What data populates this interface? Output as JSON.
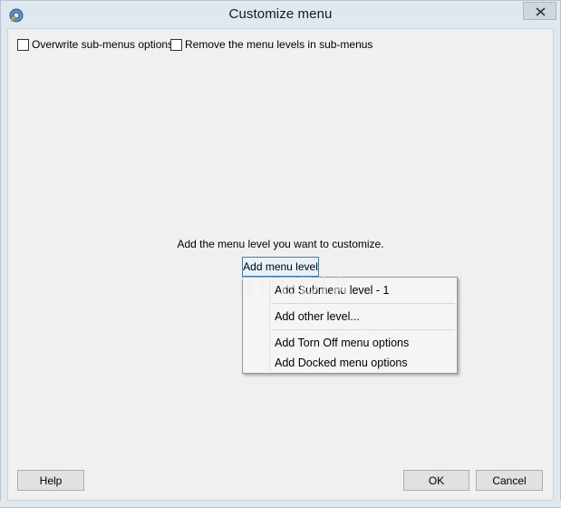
{
  "window": {
    "title": "Customize menu",
    "close_icon": "close-icon",
    "app_icon": "gear-wrench-icon"
  },
  "options": {
    "overwrite_label": "Overwrite sub-menus options",
    "remove_levels_label": "Remove the menu levels in sub-menus"
  },
  "main": {
    "prompt": "Add the menu level you want to customize.",
    "add_button": "Add menu level"
  },
  "menu": {
    "items": [
      {
        "label": "Add Submenu level - 1"
      },
      {
        "label": "Add other level..."
      },
      {
        "label": "Add Torn Off menu options"
      },
      {
        "label": "Add Docked menu options"
      }
    ]
  },
  "watermark": "SOFTPEDIA",
  "footer": {
    "help": "Help",
    "ok": "OK",
    "cancel": "Cancel"
  }
}
